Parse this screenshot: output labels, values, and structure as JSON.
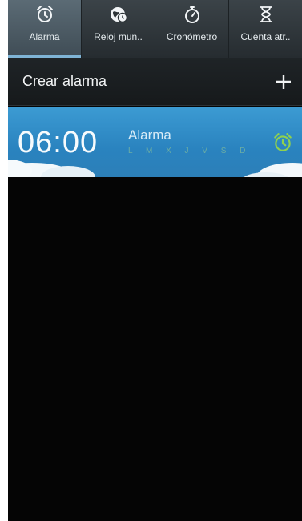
{
  "tabs": [
    {
      "label": "Alarma",
      "icon": "alarm-clock-icon",
      "active": true
    },
    {
      "label": "Reloj mun..",
      "icon": "world-clock-icon",
      "active": false
    },
    {
      "label": "Cronómetro",
      "icon": "stopwatch-icon",
      "active": false
    },
    {
      "label": "Cuenta atr..",
      "icon": "hourglass-icon",
      "active": false
    }
  ],
  "create_alarm": {
    "label": "Crear alarma",
    "icon": "plus-icon"
  },
  "alarm": {
    "time": "06:00",
    "name": "Alarma",
    "days": "L M X J V S D",
    "toggle_icon": "alarm-clock-icon",
    "toggle_color": "#8fd14f"
  },
  "colors": {
    "accent": "#7fb4d6",
    "card": "#2a83bf",
    "background": "#050505"
  }
}
